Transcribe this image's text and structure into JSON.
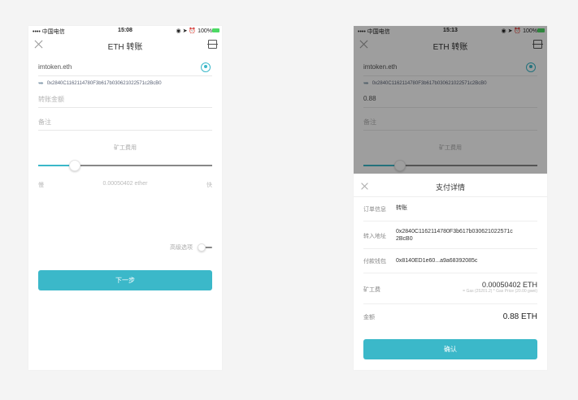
{
  "status": {
    "carrier": "•••• 中国电信",
    "time_left": "15:08",
    "time_right": "15:13",
    "icons": "◉ ➤ ⏰",
    "battery": "100%"
  },
  "nav": {
    "title": "ETH 转账"
  },
  "form": {
    "recipient_name": "imtoken.eth",
    "recipient_address": "0x2840C1162114780F3b617b030621022571c2BcB0",
    "amount_placeholder": "转账金额",
    "amount_value": "0.88",
    "note_placeholder": "备注",
    "fee_label": "矿工费用",
    "fee_slow": "慢",
    "fee_value": "0.00050402 ether",
    "fee_fast": "快",
    "fee_position": 0.21,
    "advanced_label": "高级选项",
    "next_button": "下一步"
  },
  "payment": {
    "title": "支付详情",
    "order_label": "订单信息",
    "order_value": "转账",
    "to_label": "转入地址",
    "to_value_line1": "0x2840C1162114780F3b617b030621022571c",
    "to_value_line2": "2BcB0",
    "from_label": "付款钱包",
    "from_value": "0x8140ED1e60...a9a68392085c",
    "gas_label": "矿工费",
    "gas_value": "0.00050402 ETH",
    "gas_detail": "= Gas (25201.2) * Gas Price (20.00 gwei)",
    "amount_label": "金额",
    "amount_value": "0.88 ETH",
    "confirm_button": "确认"
  },
  "colors": {
    "accent": "#3bb8c9"
  }
}
